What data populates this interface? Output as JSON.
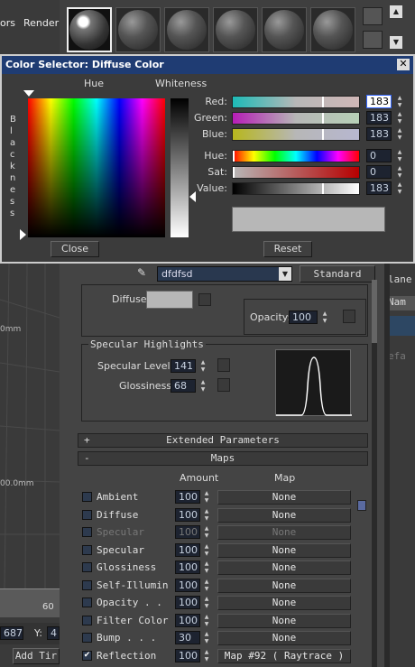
{
  "top_menu": {
    "item1": "ors",
    "item2": "Renderi"
  },
  "dialog": {
    "title": "Color Selector: Diffuse Color",
    "hue_label": "Hue",
    "whiteness_label": "Whiteness",
    "blackness_label": "B l a c k n e s s",
    "channels": [
      {
        "label": "Red:",
        "value": "183"
      },
      {
        "label": "Green:",
        "value": "183"
      },
      {
        "label": "Blue:",
        "value": "183"
      },
      {
        "label": "Hue:",
        "value": "0"
      },
      {
        "label": "Sat:",
        "value": "0"
      },
      {
        "label": "Value:",
        "value": "183"
      }
    ],
    "close_label": "Close",
    "reset_label": "Reset",
    "swatch_color": "#b7b7b7"
  },
  "material": {
    "name": "dfdfsd",
    "type": "Standard",
    "diffuse_label": "Diffuse:",
    "opacity_label": "Opacity:",
    "opacity_value": "100"
  },
  "specular": {
    "title": "Specular Highlights",
    "level_label": "Specular Level:",
    "level_value": "141",
    "gloss_label": "Glossiness:",
    "gloss_value": "68"
  },
  "rollouts": {
    "extended": "Extended Parameters",
    "extended_sign": "+",
    "maps": "Maps",
    "maps_sign": "-",
    "amount_header": "Amount",
    "map_header": "Map"
  },
  "maps": [
    {
      "label": "Ambient",
      "amount": "100",
      "map": "None",
      "checked": false,
      "dim": false
    },
    {
      "label": "Diffuse",
      "amount": "100",
      "map": "None",
      "checked": false,
      "dim": false
    },
    {
      "label": "Specular",
      "amount": "100",
      "map": "None",
      "checked": false,
      "dim": true
    },
    {
      "label": "Specular",
      "amount": "100",
      "map": "None",
      "checked": false,
      "dim": false
    },
    {
      "label": "Glossiness",
      "amount": "100",
      "map": "None",
      "checked": false,
      "dim": false
    },
    {
      "label": "Self-Illumin",
      "amount": "100",
      "map": "None",
      "checked": false,
      "dim": false
    },
    {
      "label": "Opacity . .",
      "amount": "100",
      "map": "None",
      "checked": false,
      "dim": false
    },
    {
      "label": "Filter Color",
      "amount": "100",
      "map": "None",
      "checked": false,
      "dim": false
    },
    {
      "label": "Bump . . .",
      "amount": "30",
      "map": "None",
      "checked": false,
      "dim": false
    },
    {
      "label": "Reflection",
      "amount": "100",
      "map": "Map #92  ( Raytrace )",
      "checked": true,
      "dim": false
    }
  ],
  "viewport": {
    "label1": "0mm",
    "label2": "00.0mm",
    "ruler": "60",
    "coord_x": "687",
    "coord_y_label": "Y:",
    "coord_y": "4",
    "add_time": "Add Tir"
  },
  "right_panel": {
    "label1": "lane",
    "label2": "Nam",
    "label3": "efa"
  }
}
